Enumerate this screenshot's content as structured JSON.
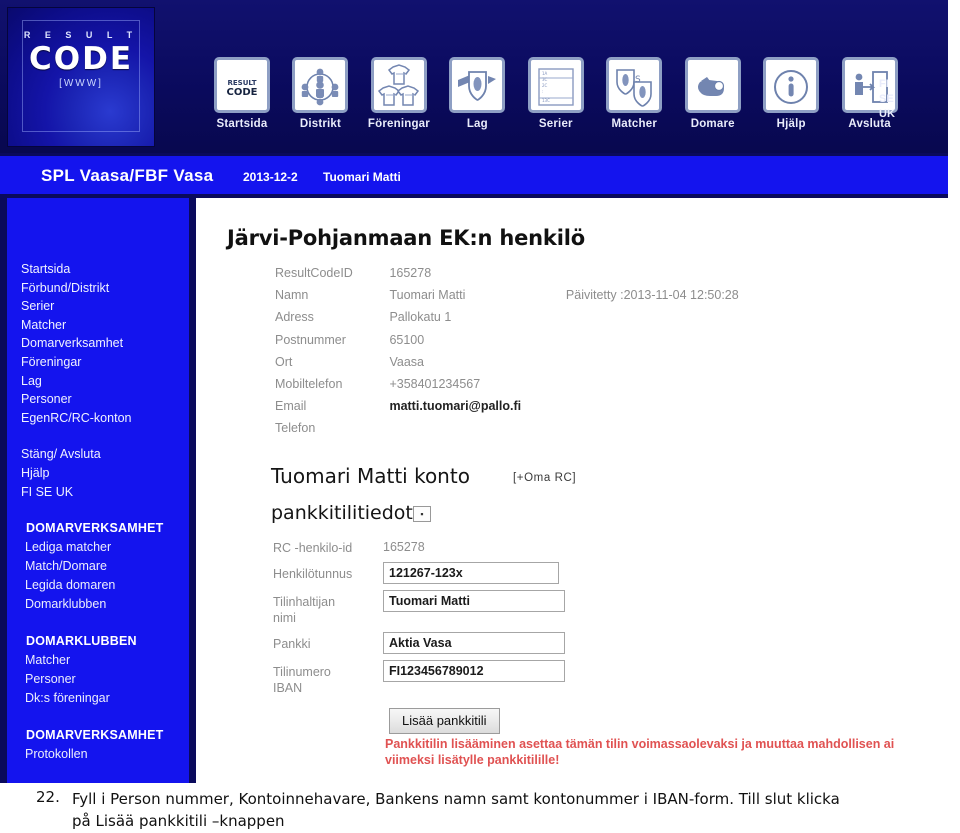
{
  "app": {
    "logo": {
      "line1": "R E S U L T",
      "line2": "CODE",
      "line3": "[WWW]"
    }
  },
  "topnav": {
    "items": [
      {
        "label": "Startsida",
        "icon": "resultcode-logo-icon"
      },
      {
        "label": "Distrikt",
        "icon": "people-circle-icon"
      },
      {
        "label": "Föreningar",
        "icon": "jerseys-icon"
      },
      {
        "label": "Lag",
        "icon": "shield-flag-icon"
      },
      {
        "label": "Serier",
        "icon": "standings-table-icon"
      },
      {
        "label": "Matcher",
        "icon": "two-shields-icon"
      },
      {
        "label": "Domare",
        "icon": "whistle-icon"
      },
      {
        "label": "Hjälp",
        "icon": "info-circle-icon"
      },
      {
        "label": "Avsluta",
        "icon": "exit-door-icon"
      }
    ],
    "languages": [
      "FI",
      "SE",
      "UK"
    ]
  },
  "subbar": {
    "club": "SPL Vaasa/FBF Vasa",
    "date": "2013-12-2",
    "user": "Tuomari Matti"
  },
  "sidebar": {
    "primary": [
      "Startsida",
      "Förbund/Distrikt",
      "Serier",
      "Matcher",
      "Domarverksamhet",
      "Föreningar",
      "Lag",
      "Personer",
      "EgenRC/RC-konton"
    ],
    "secondary": [
      "Stäng/ Avsluta",
      "Hjälp"
    ],
    "languages": "FI   SE   UK",
    "groups": [
      {
        "heading": "DOMARVERKSAMHET",
        "items": [
          "Lediga matcher",
          "Match/Domare",
          "Legida domaren",
          "Domarklubben"
        ]
      },
      {
        "heading": "DOMARKLUBBEN",
        "items": [
          "Matcher",
          "Personer",
          "Dk:s föreningar"
        ]
      },
      {
        "heading": "DOMARVERKSAMHET",
        "items": [
          "Protokollen"
        ]
      }
    ]
  },
  "main": {
    "title": "Järvi-Pohjanmaan EK:n henkilö",
    "person_fields": [
      {
        "label": "ResultCodeID",
        "value": "165278",
        "strong": false
      },
      {
        "label": "Namn",
        "value": "Tuomari Matti",
        "strong": false,
        "extra": "Päivitetty :2013-11-04 12:50:28"
      },
      {
        "label": "Adress",
        "value": "Pallokatu 1",
        "strong": false
      },
      {
        "label": "Postnummer",
        "value": "65100",
        "strong": false
      },
      {
        "label": "Ort",
        "value": "Vaasa",
        "strong": false
      },
      {
        "label": "Mobiltelefon",
        "value": "+358401234567",
        "strong": false
      },
      {
        "label": "Email",
        "value": "matti.tuomari@pallo.fi",
        "strong": true
      },
      {
        "label": "Telefon",
        "value": "",
        "strong": false
      }
    ],
    "account_heading": "Tuomari Matti konto",
    "oma_rc_link": "[+Oma RC]",
    "bank_heading": "pankkitilitiedot",
    "bank_toggle_glyph": "▪",
    "bank_fields": {
      "rc_id_label": "RC -henkilo-id",
      "rc_id_value": "165278",
      "hetu_label": "Henkilötunnus",
      "hetu_value": "121267-123x",
      "holder_label_l1": "Tilinhaltijan",
      "holder_label_l2": "nimi",
      "holder_value": "Tuomari Matti",
      "bank_label": "Pankki",
      "bank_value": "Aktia Vasa",
      "iban_label_l1": "Tilinumero",
      "iban_label_l2": "IBAN",
      "iban_value": "FI123456789012"
    },
    "add_button": "Lisää pankkitili",
    "warning_line1": "Pankkitilin lisääminen asettaa tämän tilin voimassaolevaksi ja muuttaa mahdollisen ai",
    "warning_line2": "viimeksi lisätylle pankkitilille!"
  },
  "caption": {
    "number": "22.",
    "line1": "Fyll i Person nummer, Kontoinnehavare, Bankens namn samt kontonummer i IBAN-form. Till slut klicka",
    "line2": "på Lisää pankkitili –knappen"
  },
  "colors": {
    "header_navy": "#0a0a5c",
    "bar_blue": "#1414ee",
    "warning_red": "#e05252",
    "label_gray": "#8d8d8d"
  }
}
